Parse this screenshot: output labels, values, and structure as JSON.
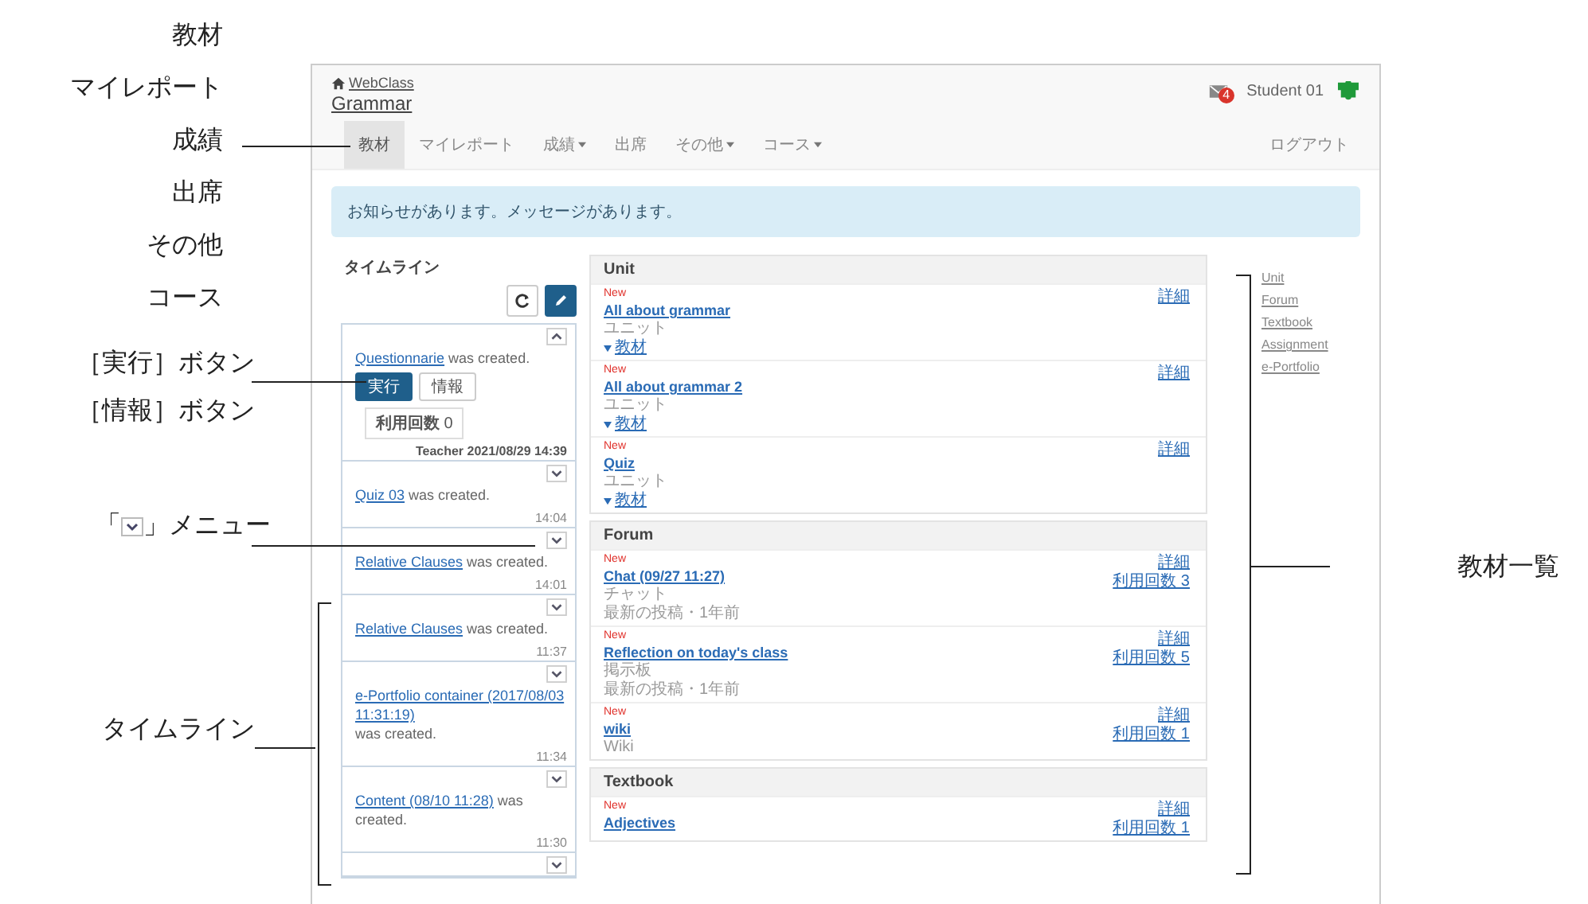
{
  "annotations": {
    "nav_labels": [
      "教材",
      "マイレポート",
      "成績",
      "出席",
      "その他",
      "コース"
    ],
    "button_labels": [
      "［実行］ボタン",
      "［情報］ボタン"
    ],
    "menu_label": {
      "open": "「",
      "close": "」メニュー"
    },
    "timeline_label": "タイムライン",
    "materials_label": "教材一覧"
  },
  "header": {
    "home_link": "WebClass",
    "course_title": "Grammar",
    "mail_badge": "4",
    "user_name": "Student 01"
  },
  "nav": {
    "items": [
      {
        "label": "教材",
        "selected": true,
        "dropdown": false
      },
      {
        "label": "マイレポート",
        "selected": false,
        "dropdown": false
      },
      {
        "label": "成績",
        "selected": false,
        "dropdown": true
      },
      {
        "label": "出席",
        "selected": false,
        "dropdown": false
      },
      {
        "label": "その他",
        "selected": false,
        "dropdown": true
      },
      {
        "label": "コース",
        "selected": false,
        "dropdown": true
      }
    ],
    "logout": "ログアウト"
  },
  "alert": "お知らせがあります。メッセージがあります。",
  "timeline": {
    "title": "タイムライン",
    "entries": [
      {
        "link": "Questionnarie",
        "text": "was created.",
        "expanded": true,
        "actions": [
          "実行",
          "情報"
        ],
        "count_label": "利用回数",
        "count": "0",
        "meta": "Teacher 2021/08/29 14:39"
      },
      {
        "link": "Quiz 03",
        "text": "was created.",
        "expanded": false,
        "meta": "14:04"
      },
      {
        "link": "Relative Clauses",
        "text": "was created.",
        "expanded": false,
        "meta": "14:01"
      },
      {
        "link": "Relative Clauses",
        "text": "was created.",
        "expanded": false,
        "meta": "11:37"
      },
      {
        "link": "e-Portfolio container (2017/08/03 11:31:19)",
        "text": "was created.",
        "expanded": false,
        "meta": "11:34"
      },
      {
        "link": "Content (08/10 11:28)",
        "text": "was created.",
        "expanded": false,
        "meta": "11:30"
      },
      {
        "expanded": false
      }
    ]
  },
  "sections": [
    {
      "title": "Unit",
      "items": [
        {
          "new": "New",
          "title": "All about grammar",
          "type": "ユニット",
          "sub_link": "教材",
          "links": [
            "詳細"
          ]
        },
        {
          "new": "New",
          "title": "All about grammar 2",
          "type": "ユニット",
          "sub_link": "教材",
          "links": [
            "詳細"
          ]
        },
        {
          "new": "New",
          "title": "Quiz",
          "type": "ユニット",
          "sub_link": "教材",
          "links": [
            "詳細"
          ]
        }
      ]
    },
    {
      "title": "Forum",
      "items": [
        {
          "new": "New",
          "title": "Chat (09/27 11:27)",
          "type": "チャット",
          "note": "最新の投稿・1年前",
          "links": [
            "詳細",
            "利用回数 3"
          ]
        },
        {
          "new": "New",
          "title": "Reflection on today's class",
          "type": "掲示板",
          "note": "最新の投稿・1年前",
          "links": [
            "詳細",
            "利用回数 5"
          ]
        },
        {
          "new": "New",
          "title": "wiki",
          "type": "Wiki",
          "links": [
            "詳細",
            "利用回数 1"
          ]
        }
      ]
    },
    {
      "title": "Textbook",
      "items": [
        {
          "new": "New",
          "title": "Adjectives",
          "links": [
            "詳細",
            "利用回数 1"
          ]
        }
      ]
    }
  ],
  "side_nav": [
    "Unit",
    "Forum",
    "Textbook",
    "Assignment",
    "e-Portfolio"
  ]
}
